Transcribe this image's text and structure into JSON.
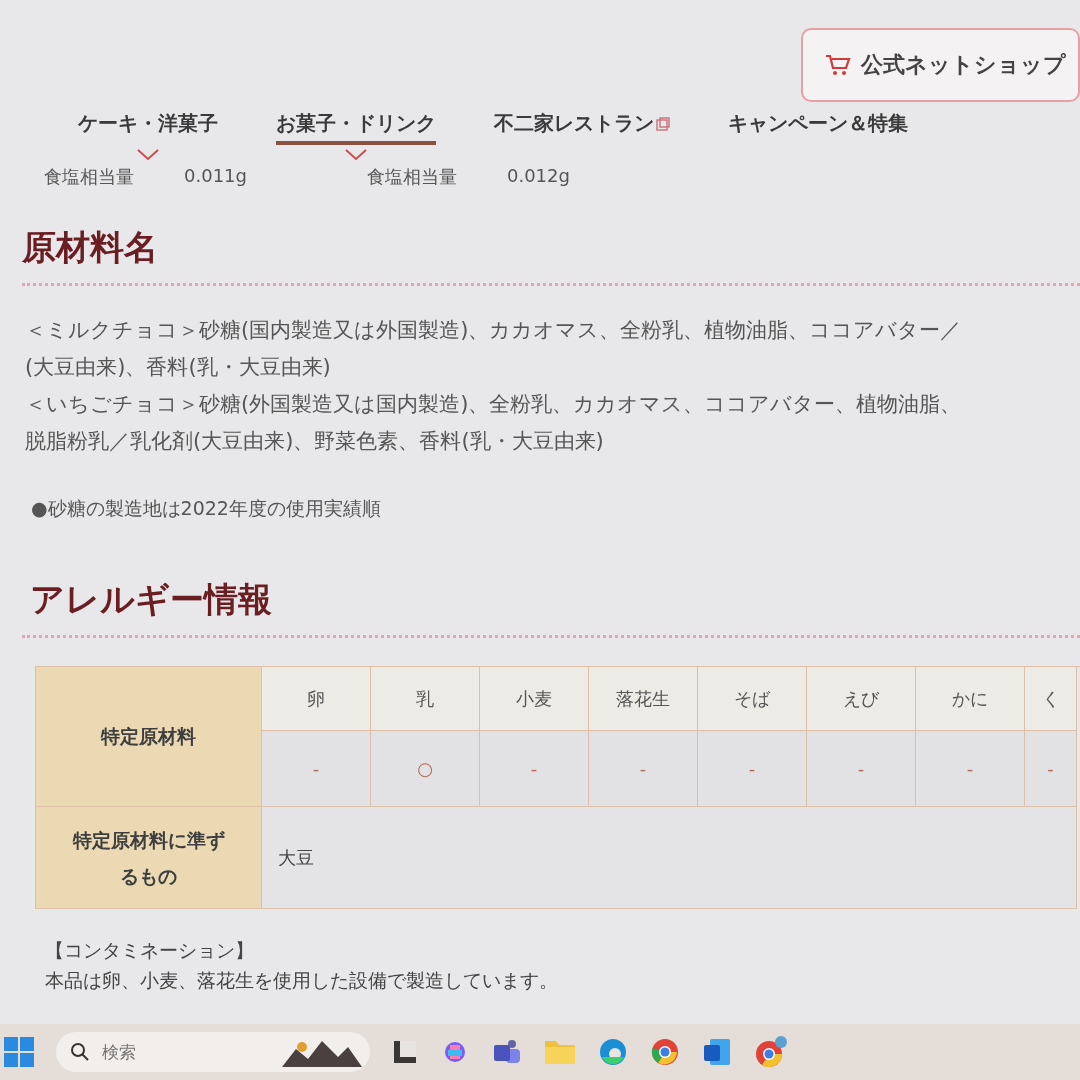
{
  "shop_button": {
    "label": "公式ネットショップ"
  },
  "nav_tabs": [
    {
      "label": "ケーキ・洋菓子",
      "kind": "dropdown",
      "selected": false
    },
    {
      "label": "お菓子・ドリンク",
      "kind": "dropdown",
      "selected": true
    },
    {
      "label": "不二家レストラン",
      "kind": "external",
      "selected": false
    },
    {
      "label": "キャンペーン＆特集",
      "kind": "plain",
      "selected": false
    }
  ],
  "nutrition_rows": [
    {
      "label": "食塩相当量",
      "value": "0.011g"
    },
    {
      "label": "食塩相当量",
      "value": "0.012g"
    }
  ],
  "ingredients": {
    "title": "原材料名",
    "lines": [
      "＜ミルクチョコ＞砂糖(国内製造又は外国製造)、カカオマス、全粉乳、植物油脂、ココアバター／",
      "(大豆由来)、香料(乳・大豆由来)",
      "＜いちごチョコ＞砂糖(外国製造又は国内製造)、全粉乳、カカオマス、ココアバター、植物油脂、",
      "脱脂粉乳／乳化剤(大豆由来)、野菜色素、香料(乳・大豆由来)"
    ],
    "note": "●砂糖の製造地は2022年度の使用実績順"
  },
  "allergy": {
    "title": "アレルギー情報",
    "row_header_1": "特定原材料",
    "columns": [
      "卵",
      "乳",
      "小麦",
      "落花生",
      "そば",
      "えび",
      "かに",
      "く"
    ],
    "values": [
      "-",
      "○",
      "-",
      "-",
      "-",
      "-",
      "-",
      "-"
    ],
    "row_header_2": "特定原材料に準ずるもの",
    "row_2_value": "大豆",
    "contamination_title": "【コンタミネーション】",
    "contamination_text": "本品は卵、小麦、落花生を使用した設備で製造しています。"
  },
  "taskbar": {
    "search_placeholder": "検索"
  }
}
